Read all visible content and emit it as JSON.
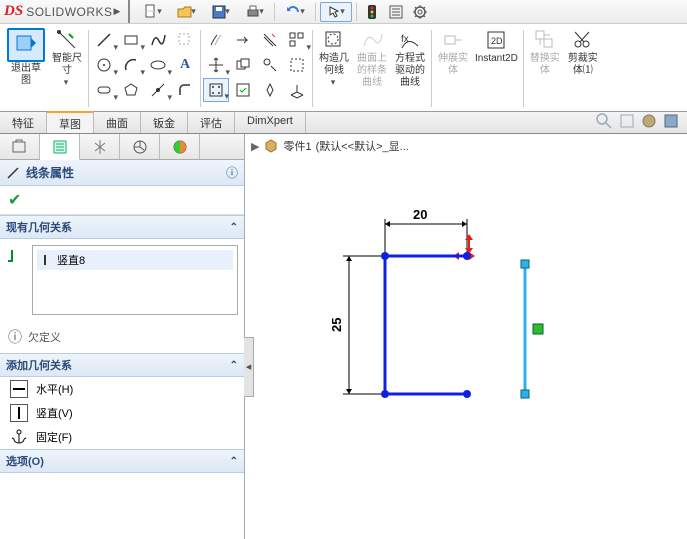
{
  "app": {
    "brand_prefix": "DS",
    "brand_name": "SOLIDWORKS"
  },
  "ribbon": {
    "exit_sketch": "退出草\n图",
    "smart_dim": "智能尺\n寸",
    "construct_geom": "构造几\n何线",
    "spline_on": "曲面上\n的样条\n曲线",
    "equation_curve": "方程式\n驱动的\n曲线",
    "extend_entity": "伸展实\n体",
    "instant2d": "Instant2D",
    "replace_entity": "替换实\n体",
    "trim_entity": "剪裁实\n体⑴"
  },
  "tabs": {
    "t1": "特征",
    "t2": "草图",
    "t3": "曲面",
    "t4": "钣金",
    "t5": "评估",
    "t6": "DimXpert"
  },
  "panel": {
    "title": "线条属性",
    "existing_rel": "现有几何关系",
    "rel_item": "竖直8",
    "underdefined": "欠定义",
    "add_rel": "添加几何关系",
    "horiz": "水平(H)",
    "vert": "竖直(V)",
    "fix": "固定(F)",
    "options": "选项(O)"
  },
  "crumb": {
    "part": "零件1",
    "state": "(默认<<默认>_显..."
  },
  "dims": {
    "w": "20",
    "h": "25"
  }
}
